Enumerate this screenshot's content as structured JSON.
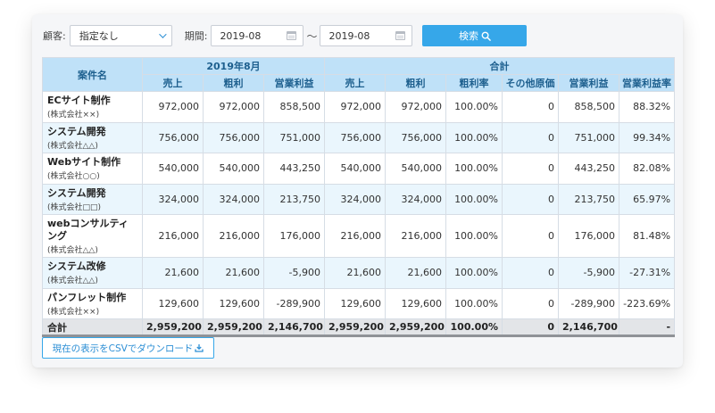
{
  "filters": {
    "customer_label": "顧客:",
    "customer_value": "指定なし",
    "period_label": "期間:",
    "date_from": "2019-08",
    "separator": "〜",
    "date_to": "2019-08",
    "search_label": "検索"
  },
  "table": {
    "name_header": "案件名",
    "group_month": "2019年8月",
    "group_total": "合計",
    "month_columns": [
      "売上",
      "粗利",
      "営業利益"
    ],
    "total_columns": [
      "売上",
      "粗利",
      "粗利率",
      "その他原価",
      "営業利益",
      "営業利益率"
    ],
    "rows": [
      {
        "name": "ECサイト制作",
        "client": "(株式会社××)",
        "cells": [
          "972,000",
          "972,000",
          "858,500",
          "972,000",
          "972,000",
          "100.00%",
          "0",
          "858,500",
          "88.32%"
        ]
      },
      {
        "name": "システム開発",
        "client": "(株式会社△△)",
        "cells": [
          "756,000",
          "756,000",
          "751,000",
          "756,000",
          "756,000",
          "100.00%",
          "0",
          "751,000",
          "99.34%"
        ]
      },
      {
        "name": "Webサイト制作",
        "client": "(株式会社○○)",
        "cells": [
          "540,000",
          "540,000",
          "443,250",
          "540,000",
          "540,000",
          "100.00%",
          "0",
          "443,250",
          "82.08%"
        ]
      },
      {
        "name": "システム開発",
        "client": "(株式会社□□)",
        "cells": [
          "324,000",
          "324,000",
          "213,750",
          "324,000",
          "324,000",
          "100.00%",
          "0",
          "213,750",
          "65.97%"
        ]
      },
      {
        "name": "webコンサルティング",
        "client": "(株式会社△△)",
        "cells": [
          "216,000",
          "216,000",
          "176,000",
          "216,000",
          "216,000",
          "100.00%",
          "0",
          "176,000",
          "81.48%"
        ]
      },
      {
        "name": "システム改修",
        "client": "(株式会社△△)",
        "cells": [
          "21,600",
          "21,600",
          "-5,900",
          "21,600",
          "21,600",
          "100.00%",
          "0",
          "-5,900",
          "-27.31%"
        ]
      },
      {
        "name": "パンフレット制作",
        "client": "(株式会社××)",
        "cells": [
          "129,600",
          "129,600",
          "-289,900",
          "129,600",
          "129,600",
          "100.00%",
          "0",
          "-289,900",
          "-223.69%"
        ]
      }
    ],
    "total_label": "合計",
    "total_cells": [
      "2,959,200",
      "2,959,200",
      "2,146,700",
      "2,959,200",
      "2,959,200",
      "100.00%",
      "0",
      "2,146,700",
      "-"
    ]
  },
  "download": {
    "label": "現在の表示をCSVでダウンロード"
  },
  "colors": {
    "accent": "#36a7e9",
    "header_bg": "#bfe1f8",
    "row_alt": "#eaf6fd",
    "total_bg": "#e3e5e8"
  },
  "icons": {
    "customer_dropdown": "chevron-down-icon",
    "date_picker": "calendar-icon",
    "search": "search-icon",
    "download": "download-icon"
  }
}
